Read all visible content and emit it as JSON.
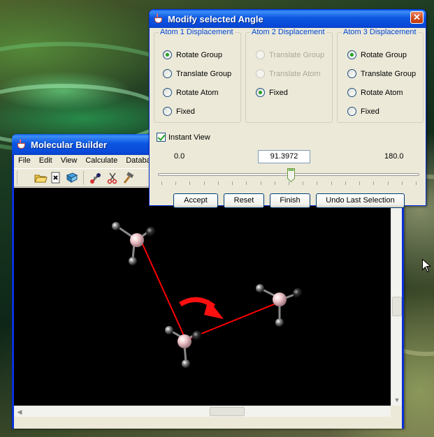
{
  "molecular_builder": {
    "title": "Molecular Builder",
    "menu": [
      "File",
      "Edit",
      "View",
      "Calculate",
      "Databa"
    ],
    "toolbar_icons": [
      "open-folder-icon",
      "close-document-icon",
      "book-icon",
      "molecule-icon",
      "scissors-icon",
      "hammer-icon"
    ]
  },
  "dialog": {
    "title": "Modify selected Angle",
    "close_label": "✕",
    "atom1": {
      "title": "Atom 1 Displacement",
      "options": [
        "Rotate Group",
        "Translate Group",
        "Rotate Atom",
        "Fixed"
      ],
      "selected": "Rotate Group"
    },
    "atom2": {
      "title": "Atom 2 Displacement",
      "options": [
        "Translate Group",
        "Translate Atom",
        "Fixed"
      ],
      "disabled": [
        "Translate Group",
        "Translate Atom"
      ],
      "selected": "Fixed"
    },
    "atom3": {
      "title": "Atom 3 Displacement",
      "options": [
        "Rotate Group",
        "Translate Group",
        "Rotate Atom",
        "Fixed"
      ],
      "selected": "Rotate Group"
    },
    "instant_view": {
      "label": "Instant View",
      "checked": true
    },
    "slider": {
      "min_label": "0.0",
      "max_label": "180.0",
      "value": "91.3972",
      "min": 0,
      "max": 180,
      "current": 91.3972
    },
    "buttons": {
      "accept": "Accept",
      "reset": "Reset",
      "finish": "Finish",
      "undo": "Undo Last Selection"
    }
  },
  "colors": {
    "titlebar": "#0a5fe8",
    "bond": "#ff0000",
    "arrow": "#ff1010",
    "selected_radio": "#21a121"
  }
}
